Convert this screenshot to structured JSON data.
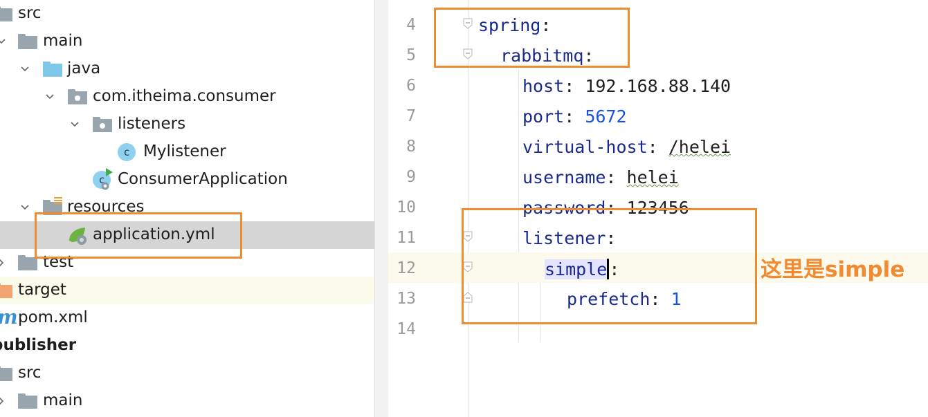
{
  "project_tree": {
    "items": [
      {
        "label": "src"
      },
      {
        "label": "main"
      },
      {
        "label": "java"
      },
      {
        "label": "com.itheima.consumer"
      },
      {
        "label": "listeners"
      },
      {
        "label": "Mylistener",
        "icon_letter": "c"
      },
      {
        "label": "ConsumerApplication",
        "icon_letter": "c"
      },
      {
        "label": "resources"
      },
      {
        "label": "application.yml"
      },
      {
        "label": "test"
      },
      {
        "label": "target"
      },
      {
        "label": "pom.xml"
      },
      {
        "label": "publisher"
      },
      {
        "label": "src"
      },
      {
        "label": "main"
      }
    ]
  },
  "editor": {
    "lines": [
      {
        "number": "4",
        "key": "spring",
        "sep": ":"
      },
      {
        "number": "5",
        "key": "rabbitmq",
        "sep": ":"
      },
      {
        "number": "6",
        "key": "host",
        "sep": ": ",
        "value": "192.168.88.140"
      },
      {
        "number": "7",
        "key": "port",
        "sep": ": ",
        "value": "5672"
      },
      {
        "number": "8",
        "key": "virtual-host",
        "sep": ": ",
        "value": "/helei"
      },
      {
        "number": "9",
        "key": "username",
        "sep": ": ",
        "value": "helei"
      },
      {
        "number": "10",
        "key": "password",
        "sep": ": ",
        "value": "123456"
      },
      {
        "number": "11",
        "key": "listener",
        "sep": ":"
      },
      {
        "number": "12",
        "key": "simple",
        "sep": ":"
      },
      {
        "number": "13",
        "key": "prefetch",
        "sep": ": ",
        "value": "1"
      },
      {
        "number": "14"
      }
    ]
  },
  "annotation": {
    "text": "这里是simple",
    "color": "#f28a30"
  },
  "colors": {
    "yaml_key": "#1a2a8c",
    "yaml_number": "#1750eb",
    "selection_row": "#d5d5d5"
  }
}
